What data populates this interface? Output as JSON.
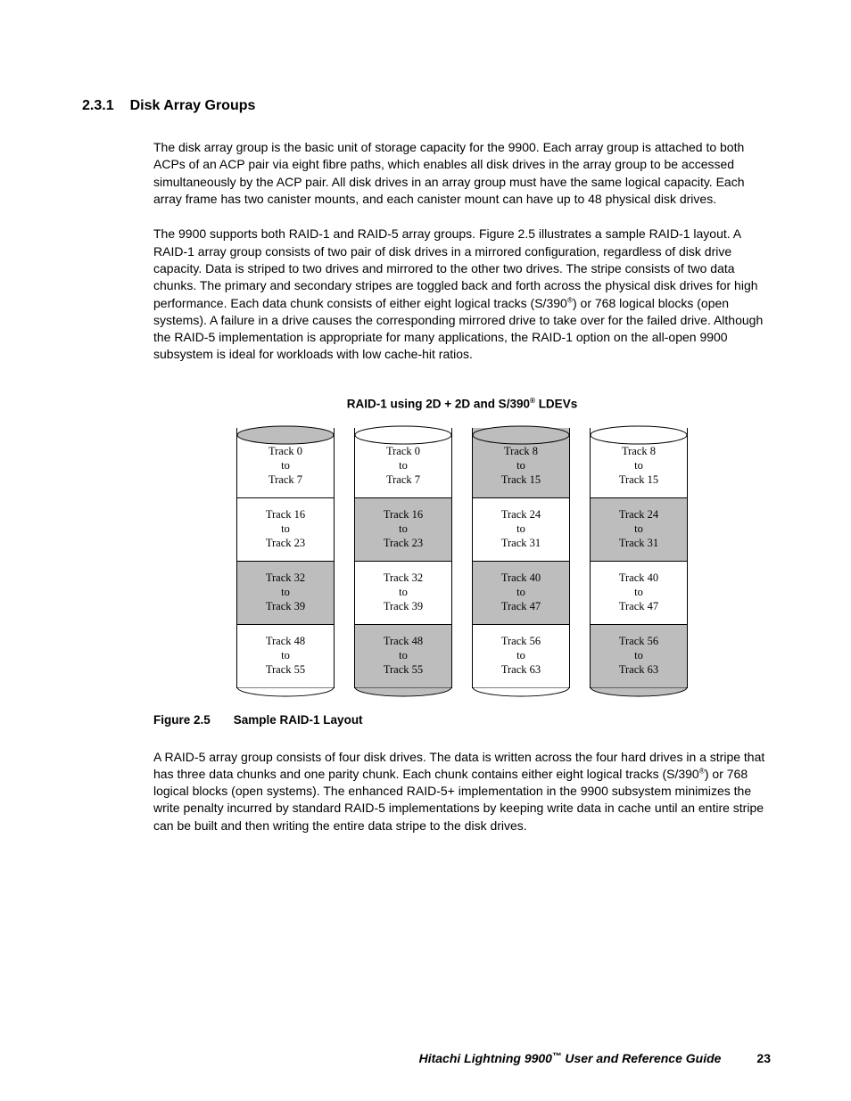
{
  "heading": {
    "number": "2.3.1",
    "title": "Disk Array Groups"
  },
  "paragraphs": {
    "p1": "The disk array group is the basic unit of storage capacity for the 9900. Each array group is attached to both ACPs of an ACP pair via eight fibre paths, which enables all disk drives in the array group to be accessed simultaneously by the ACP pair. All disk drives in an array group must have the same logical capacity. Each array frame has two canister mounts, and each canister mount can have up to 48 physical disk drives.",
    "p2a": "The 9900 supports both RAID-1 and RAID-5 array groups. Figure 2.5 illustrates a sample RAID-1 layout. A RAID-1 array group consists of two pair of disk drives in a mirrored configuration, regardless of disk drive capacity. Data is striped to two drives and mirrored to the other two drives. The stripe consists of two data chunks. The primary and secondary stripes are toggled back and forth across the physical disk drives for high performance. Each data chunk consists of either eight logical tracks (S/390",
    "p2b": ") or 768 logical blocks (open systems). A failure in a drive causes the corresponding mirrored drive to take over for the failed drive. Although the RAID-5 implementation is appropriate for many applications, the RAID-1 option on the all-open 9900 subsystem is ideal for workloads with low cache-hit ratios.",
    "p3a": "A RAID-5 array group consists of four disk drives. The data is written across the four hard drives in a stripe that has three data chunks and one parity chunk. Each chunk contains either eight logical tracks (S/390",
    "p3b": ") or 768 logical blocks (open systems). The enhanced RAID-5+ implementation in the 9900 subsystem minimizes the write penalty incurred by standard RAID-5 implementations by keeping write data in cache until an entire stripe can be built and then writing the entire data stripe to the disk drives."
  },
  "figure": {
    "title_a": "RAID-1 using 2D + 2D and S/390",
    "title_b": " LDEVs",
    "caption_num": "Figure 2.5",
    "caption_text": "Sample RAID-1 Layout",
    "cylinders": [
      {
        "topFill": "#bdbdbd",
        "bands": [
          {
            "shaded": false,
            "l1": "Track 0",
            "l2": "to",
            "l3": "Track 7"
          },
          {
            "shaded": false,
            "l1": "Track 16",
            "l2": "to",
            "l3": "Track 23"
          },
          {
            "shaded": true,
            "l1": "Track 32",
            "l2": "to",
            "l3": "Track 39"
          },
          {
            "shaded": false,
            "l1": "Track 48",
            "l2": "to",
            "l3": "Track 55"
          }
        ],
        "bottomFill": "#ffffff"
      },
      {
        "topFill": "#ffffff",
        "bands": [
          {
            "shaded": false,
            "l1": "Track 0",
            "l2": "to",
            "l3": "Track 7"
          },
          {
            "shaded": true,
            "l1": "Track 16",
            "l2": "to",
            "l3": "Track 23"
          },
          {
            "shaded": false,
            "l1": "Track 32",
            "l2": "to",
            "l3": "Track 39"
          },
          {
            "shaded": true,
            "l1": "Track 48",
            "l2": "to",
            "l3": "Track 55"
          }
        ],
        "bottomFill": "#bdbdbd"
      },
      {
        "topFill": "#bdbdbd",
        "bands": [
          {
            "shaded": true,
            "l1": "Track 8",
            "l2": "to",
            "l3": "Track 15"
          },
          {
            "shaded": false,
            "l1": "Track 24",
            "l2": "to",
            "l3": "Track 31"
          },
          {
            "shaded": true,
            "l1": "Track 40",
            "l2": "to",
            "l3": "Track 47"
          },
          {
            "shaded": false,
            "l1": "Track 56",
            "l2": "to",
            "l3": "Track 63"
          }
        ],
        "bottomFill": "#ffffff"
      },
      {
        "topFill": "#ffffff",
        "bands": [
          {
            "shaded": false,
            "l1": "Track 8",
            "l2": "to",
            "l3": "Track 15"
          },
          {
            "shaded": true,
            "l1": "Track 24",
            "l2": "to",
            "l3": "Track 31"
          },
          {
            "shaded": false,
            "l1": "Track 40",
            "l2": "to",
            "l3": "Track 47"
          },
          {
            "shaded": true,
            "l1": "Track 56",
            "l2": "to",
            "l3": "Track 63"
          }
        ],
        "bottomFill": "#bdbdbd"
      }
    ]
  },
  "footer": {
    "title": "Hitachi Lightning 9900",
    "tm": "™",
    "rest": " User and Reference Guide",
    "page": "23"
  },
  "reg": "®"
}
